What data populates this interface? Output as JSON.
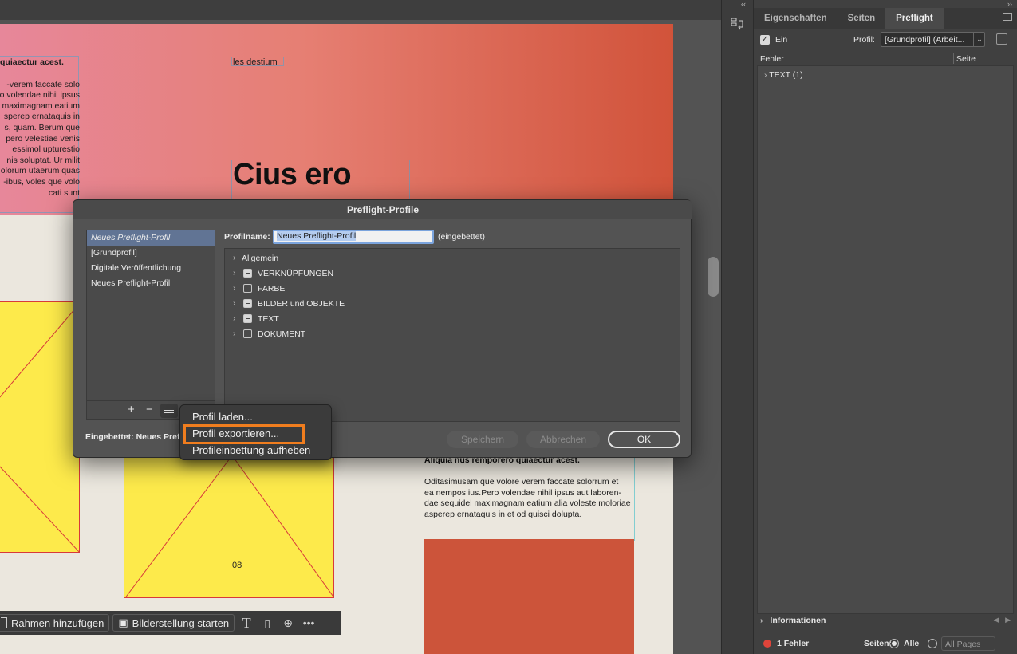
{
  "document": {
    "left_column": {
      "heading": "quiaectur acest.",
      "lines": [
        "verem faccate solo-",
        "o volendae nihil ipsus",
        "maximagnam eatium",
        "sperep ernataquis in",
        "s, quam. Berum que",
        "pero velestiae venis",
        "essimol upturestio",
        "nis soluptat. Ur milit",
        "olorum utaerum quas",
        "ibus, voles que volo-",
        "cati sunt"
      ]
    },
    "top_label": "les destium",
    "main_heading": "Cius ero",
    "page_number": "08",
    "right_column": {
      "heading": "Aliquia nus remporero quiaectur acest.",
      "lines": [
        "Oditasimusam que volore verem faccate solorrum et",
        "ea nempos ius.Pero volendae nihil ipsus aut laboren-",
        "dae sequidel maximagnam eatium alia voleste moloriae",
        "asperep ernataquis in et od quisci dolupta."
      ]
    }
  },
  "context_toolbar": {
    "add_frame": "Rahmen hinzufügen",
    "start_image": "Bilderstellung starten",
    "icons": [
      "text-icon",
      "page-icon",
      "add-page-icon",
      "more-icon"
    ]
  },
  "panel": {
    "tabs": [
      "Eigenschaften",
      "Seiten",
      "Preflight"
    ],
    "active_tab": "Preflight",
    "ein_label": "Ein",
    "profil_label": "Profil:",
    "profil_value": "[Grundprofil] (Arbeit...",
    "col_fehler": "Fehler",
    "col_seite": "Seite",
    "error_row": "TEXT (1)",
    "info": "Informationen",
    "error_count": "1 Fehler",
    "seiten_label": "Seiten:",
    "alle_label": "Alle",
    "pages_value": "All Pages",
    "error_color": "#e0443a"
  },
  "dialog": {
    "title": "Preflight-Profile",
    "profiles": [
      "Neues Preflight-Profil",
      "[Grundprofil]",
      "Digitale Veröffentlichung",
      "Neues Preflight-Profil"
    ],
    "selected_profile_index": 0,
    "profilname_label": "Profilname:",
    "profilname_value": "Neues Preflight-Profil",
    "embedded_suffix": "(eingebettet)",
    "tree": [
      {
        "label": "Allgemein",
        "box": "none"
      },
      {
        "label": "VERKNÜPFUNGEN",
        "box": "mixed"
      },
      {
        "label": "FARBE",
        "box": "empty"
      },
      {
        "label": "BILDER und OBJEKTE",
        "box": "mixed"
      },
      {
        "label": "TEXT",
        "box": "mixed"
      },
      {
        "label": "DOKUMENT",
        "box": "empty"
      }
    ],
    "embedded_label": "Eingebettet: Neues Preflight-Profil",
    "save": "Speichern",
    "cancel": "Abbrechen",
    "ok": "OK",
    "add_symbol": "+",
    "remove_symbol": "−"
  },
  "popup_menu": {
    "items": [
      "Profil laden...",
      "Profil exportieren...",
      "Profileinbettung aufheben"
    ],
    "highlighted_index": 1,
    "highlight_color": "#f07d1e"
  },
  "colors": {
    "accent_selection": "#617494",
    "document_red": "#cc543a",
    "frame_yellow": "#fdea4b"
  }
}
